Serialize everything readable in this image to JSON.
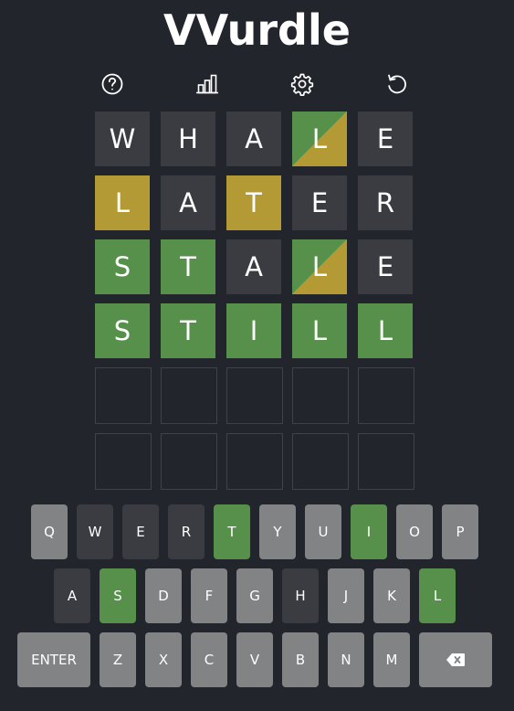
{
  "app": {
    "title": "VVurdle"
  },
  "toolbar": {
    "icons": [
      {
        "name": "help-icon"
      },
      {
        "name": "stats-icon"
      },
      {
        "name": "settings-icon"
      },
      {
        "name": "restart-icon"
      }
    ]
  },
  "colors": {
    "background": "#22252b",
    "correct": "#56904b",
    "present": "#b49a34",
    "absent": "#3a3c41",
    "unused_key": "#818384",
    "empty_border": "#3f4249"
  },
  "board": {
    "rows": [
      [
        {
          "letter": "W",
          "state": "absent"
        },
        {
          "letter": "H",
          "state": "absent"
        },
        {
          "letter": "A",
          "state": "absent"
        },
        {
          "letter": "L",
          "state": "split"
        },
        {
          "letter": "E",
          "state": "absent"
        }
      ],
      [
        {
          "letter": "L",
          "state": "present"
        },
        {
          "letter": "A",
          "state": "absent"
        },
        {
          "letter": "T",
          "state": "present"
        },
        {
          "letter": "E",
          "state": "absent"
        },
        {
          "letter": "R",
          "state": "absent"
        }
      ],
      [
        {
          "letter": "S",
          "state": "correct"
        },
        {
          "letter": "T",
          "state": "correct"
        },
        {
          "letter": "A",
          "state": "absent"
        },
        {
          "letter": "L",
          "state": "split"
        },
        {
          "letter": "E",
          "state": "absent"
        }
      ],
      [
        {
          "letter": "S",
          "state": "correct"
        },
        {
          "letter": "T",
          "state": "correct"
        },
        {
          "letter": "I",
          "state": "correct"
        },
        {
          "letter": "L",
          "state": "correct"
        },
        {
          "letter": "L",
          "state": "correct"
        }
      ],
      [
        {
          "letter": "",
          "state": "empty"
        },
        {
          "letter": "",
          "state": "empty"
        },
        {
          "letter": "",
          "state": "empty"
        },
        {
          "letter": "",
          "state": "empty"
        },
        {
          "letter": "",
          "state": "empty"
        }
      ],
      [
        {
          "letter": "",
          "state": "empty"
        },
        {
          "letter": "",
          "state": "empty"
        },
        {
          "letter": "",
          "state": "empty"
        },
        {
          "letter": "",
          "state": "empty"
        },
        {
          "letter": "",
          "state": "empty"
        }
      ]
    ]
  },
  "keyboard": {
    "rows": [
      [
        {
          "label": "Q",
          "state": "unused"
        },
        {
          "label": "W",
          "state": "absent"
        },
        {
          "label": "E",
          "state": "absent"
        },
        {
          "label": "R",
          "state": "absent"
        },
        {
          "label": "T",
          "state": "correct"
        },
        {
          "label": "Y",
          "state": "unused"
        },
        {
          "label": "U",
          "state": "unused"
        },
        {
          "label": "I",
          "state": "correct"
        },
        {
          "label": "O",
          "state": "unused"
        },
        {
          "label": "P",
          "state": "unused"
        }
      ],
      [
        {
          "label": "A",
          "state": "absent"
        },
        {
          "label": "S",
          "state": "correct"
        },
        {
          "label": "D",
          "state": "unused"
        },
        {
          "label": "F",
          "state": "unused"
        },
        {
          "label": "G",
          "state": "unused"
        },
        {
          "label": "H",
          "state": "absent"
        },
        {
          "label": "J",
          "state": "unused"
        },
        {
          "label": "K",
          "state": "unused"
        },
        {
          "label": "L",
          "state": "correct"
        }
      ],
      [
        {
          "label": "ENTER",
          "state": "unused",
          "kind": "enter"
        },
        {
          "label": "Z",
          "state": "unused"
        },
        {
          "label": "X",
          "state": "unused"
        },
        {
          "label": "C",
          "state": "unused"
        },
        {
          "label": "V",
          "state": "unused"
        },
        {
          "label": "B",
          "state": "unused"
        },
        {
          "label": "N",
          "state": "unused"
        },
        {
          "label": "M",
          "state": "unused"
        },
        {
          "label": "",
          "state": "unused",
          "kind": "backspace",
          "icon": "backspace-icon"
        }
      ]
    ]
  }
}
